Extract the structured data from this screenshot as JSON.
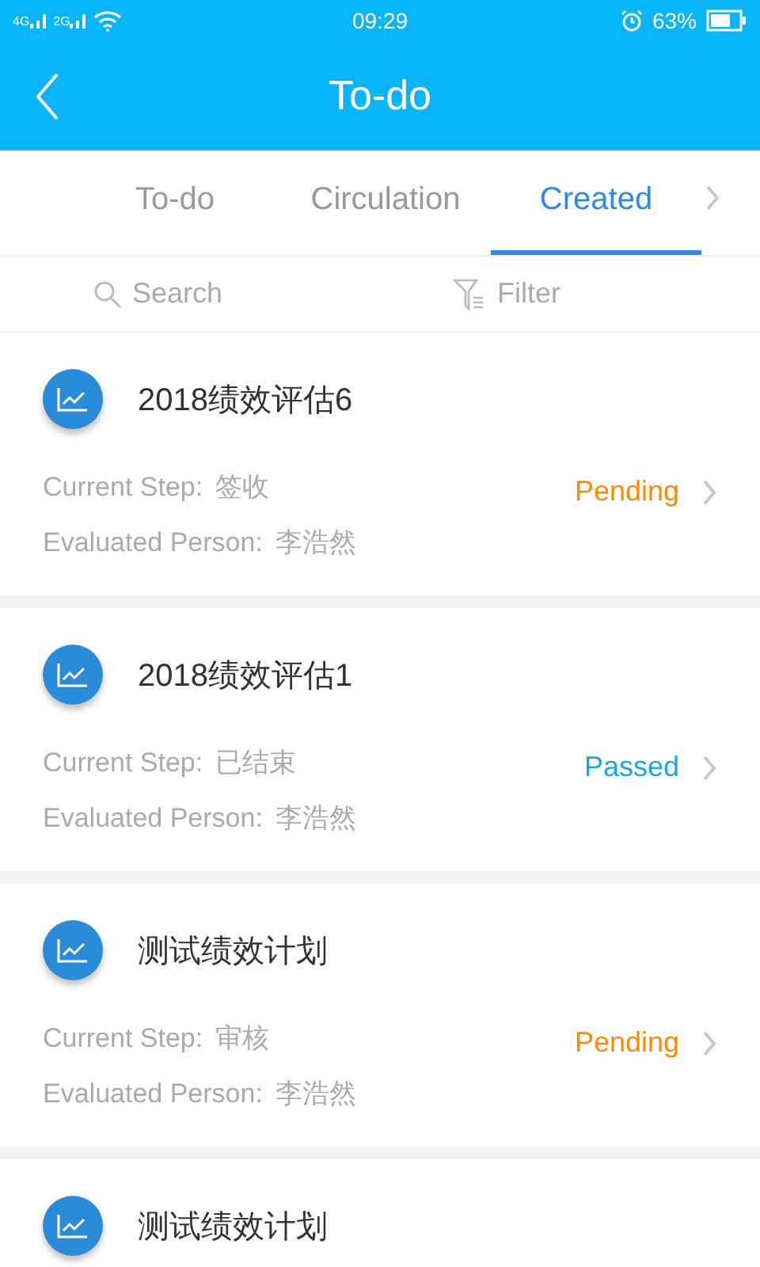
{
  "status_bar": {
    "network_1": "4G",
    "network_2": "2G",
    "time": "09:29",
    "battery": "63%"
  },
  "header": {
    "title": "To-do"
  },
  "tabs": [
    {
      "label": "To-do",
      "selected": false
    },
    {
      "label": "Circulation",
      "selected": false
    },
    {
      "label": "Created",
      "selected": true
    }
  ],
  "tools": {
    "search": "Search",
    "filter": "Filter"
  },
  "items": [
    {
      "title": "2018绩效评估6",
      "step_label": "Current Step:",
      "step": "签收",
      "person_label": "Evaluated Person:",
      "person": "李浩然",
      "status": "Pending",
      "kind": "pending"
    },
    {
      "title": "2018绩效评估1",
      "step_label": "Current Step:",
      "step": "已结束",
      "person_label": "Evaluated Person:",
      "person": "李浩然",
      "status": "Passed",
      "kind": "passed"
    },
    {
      "title": "测试绩效计划",
      "step_label": "Current Step:",
      "step": "审核",
      "person_label": "Evaluated Person:",
      "person": "李浩然",
      "status": "Pending",
      "kind": "pending"
    },
    {
      "title": "测试绩效计划"
    }
  ]
}
